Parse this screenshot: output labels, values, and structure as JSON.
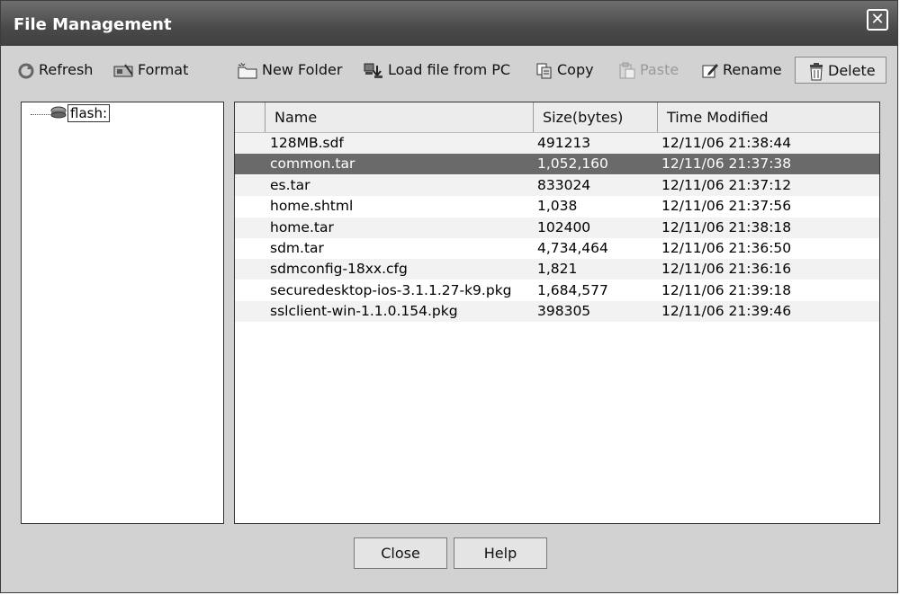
{
  "window": {
    "title": "File Management"
  },
  "toolbar": {
    "refresh_label": "Refresh",
    "format_label": "Format",
    "new_folder_label": "New Folder",
    "load_file_label": "Load file from PC",
    "copy_label": "Copy",
    "paste_label": "Paste",
    "rename_label": "Rename",
    "delete_label": "Delete"
  },
  "tree": {
    "root_label": "flash:"
  },
  "table": {
    "columns": [
      "Name",
      "Size(bytes)",
      "Time Modified"
    ],
    "rows": [
      {
        "name": "128MB.sdf",
        "size": "491213",
        "time": "12/11/06 21:38:44"
      },
      {
        "name": "common.tar",
        "size": "1,052,160",
        "time": "12/11/06 21:37:38",
        "selected": true
      },
      {
        "name": "es.tar",
        "size": "833024",
        "time": "12/11/06 21:37:12"
      },
      {
        "name": "home.shtml",
        "size": "1,038",
        "time": "12/11/06 21:37:56"
      },
      {
        "name": "home.tar",
        "size": "102400",
        "time": "12/11/06 21:38:18"
      },
      {
        "name": "sdm.tar",
        "size": "4,734,464",
        "time": "12/11/06 21:36:50"
      },
      {
        "name": "sdmconfig-18xx.cfg",
        "size": "1,821",
        "time": "12/11/06 21:36:16"
      },
      {
        "name": "securedesktop-ios-3.1.1.27-k9.pkg",
        "size": "1,684,577",
        "time": "12/11/06 21:39:18"
      },
      {
        "name": "sslclient-win-1.1.0.154.pkg",
        "size": "398305",
        "time": "12/11/06 21:39:46"
      }
    ]
  },
  "footer": {
    "close_label": "Close",
    "help_label": "Help"
  },
  "icons": [
    "refresh-icon",
    "format-icon",
    "new-folder-icon",
    "load-file-icon",
    "copy-icon",
    "paste-icon",
    "rename-icon",
    "delete-icon",
    "flash-device-icon",
    "close-icon"
  ]
}
